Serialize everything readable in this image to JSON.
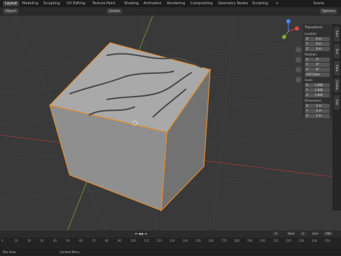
{
  "workspaces": [
    "Layout",
    "Modeling",
    "Sculpting",
    "UV Editing",
    "Texture Paint",
    "Shading",
    "Animation",
    "Rendering",
    "Compositing",
    "Geometry Nodes",
    "Scripting",
    "+"
  ],
  "scene_label": "Scene",
  "header": {
    "object_mode": "Object",
    "transform": "Global",
    "options": "Options"
  },
  "npanel": {
    "title": "Transform",
    "location_label": "Location",
    "location": [
      [
        "X",
        "0 m"
      ],
      [
        "Y",
        "0 m"
      ],
      [
        "Z",
        "0 m"
      ]
    ],
    "rotation_label": "Rotation",
    "rotation": [
      [
        "X",
        "0°"
      ],
      [
        "Y",
        "0°"
      ],
      [
        "Z",
        "0°"
      ]
    ],
    "rotation_mode": "XYZ Euler",
    "scale_label": "Scale",
    "scale": [
      [
        "X",
        "1.000"
      ],
      [
        "Y",
        "1.000"
      ],
      [
        "Z",
        "1.000"
      ]
    ],
    "dimensions_label": "Dimensions",
    "dimensions": [
      [
        "X",
        "2 m"
      ],
      [
        "Y",
        "2 m"
      ],
      [
        "Z",
        "2 m"
      ]
    ]
  },
  "side_tabs": [
    "Item",
    "Tool",
    "View",
    "Create",
    "Edit"
  ],
  "timeline": {
    "current_frame": "1",
    "start": "1",
    "end": "250",
    "start_label": "Start",
    "end_label": "End",
    "ticks": [
      "0",
      "10",
      "20",
      "30",
      "40",
      "50",
      "60",
      "70",
      "80",
      "90",
      "100",
      "110",
      "120",
      "130",
      "140",
      "150",
      "160",
      "170",
      "180",
      "190",
      "200",
      "210",
      "220",
      "230",
      "240",
      "250"
    ]
  },
  "status": {
    "left": "Pan View",
    "mid": "Context Menu"
  }
}
